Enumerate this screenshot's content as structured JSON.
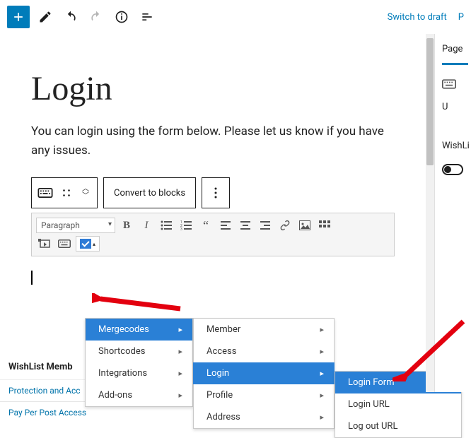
{
  "topbar": {
    "switch_to_draft": "Switch to draft",
    "p_trunc": "P"
  },
  "page": {
    "title": "Login",
    "intro": "You can login using the form below. Please let us know if you have any issues."
  },
  "block_toolbar": {
    "convert": "Convert to blocks"
  },
  "mce": {
    "format": "Paragraph"
  },
  "menu1": {
    "items": [
      {
        "label": "Mergecodes",
        "selected": true
      },
      {
        "label": "Shortcodes",
        "selected": false
      },
      {
        "label": "Integrations",
        "selected": false
      },
      {
        "label": "Add-ons",
        "selected": false
      }
    ]
  },
  "menu2": {
    "items": [
      {
        "label": "Member",
        "selected": false
      },
      {
        "label": "Access",
        "selected": false
      },
      {
        "label": "Login",
        "selected": true
      },
      {
        "label": "Profile",
        "selected": false
      },
      {
        "label": "Address",
        "selected": false
      }
    ]
  },
  "menu3": {
    "items": [
      {
        "label": "Login Form",
        "selected": true,
        "has_sub": false
      },
      {
        "label": "Login URL",
        "selected": false,
        "has_sub": false
      },
      {
        "label": "Log out URL",
        "selected": false,
        "has_sub": false
      }
    ]
  },
  "admin": {
    "heading": "WishList Memb",
    "link1": "Protection and Acc",
    "link2": "Pay Per Post Access"
  },
  "rsidebar": {
    "tab": "Page",
    "keyboard_trunc": "U",
    "wishlist_label": "WishLi"
  }
}
